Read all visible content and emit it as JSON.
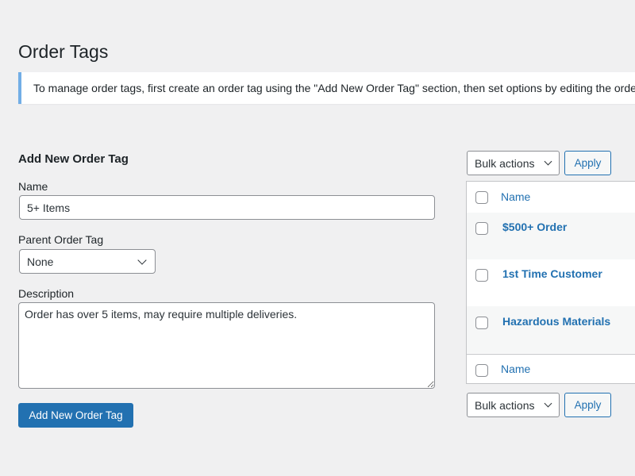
{
  "page": {
    "title": "Order Tags",
    "notice": "To manage order tags, first create an order tag using the \"Add New Order Tag\" section, then set options by editing the order tag."
  },
  "form": {
    "title": "Add New Order Tag",
    "name_label": "Name",
    "name_value": "5+ Items",
    "parent_label": "Parent Order Tag",
    "parent_selected": "None",
    "description_label": "Description",
    "description_value": "Order has over 5 items, may require multiple deliveries.",
    "submit_label": "Add New Order Tag"
  },
  "list": {
    "bulk_actions_label": "Bulk actions",
    "apply_label": "Apply",
    "column_name": "Name",
    "rows": [
      {
        "name": "$500+ Order"
      },
      {
        "name": "1st Time Customer"
      },
      {
        "name": "Hazardous Materials"
      }
    ]
  },
  "icons": {
    "dropdown": "chevron-down-icon",
    "checkbox": "checkbox-icon"
  },
  "colors": {
    "accent": "#2271b1",
    "notice_border": "#72aee6",
    "background": "#f0f0f1"
  }
}
